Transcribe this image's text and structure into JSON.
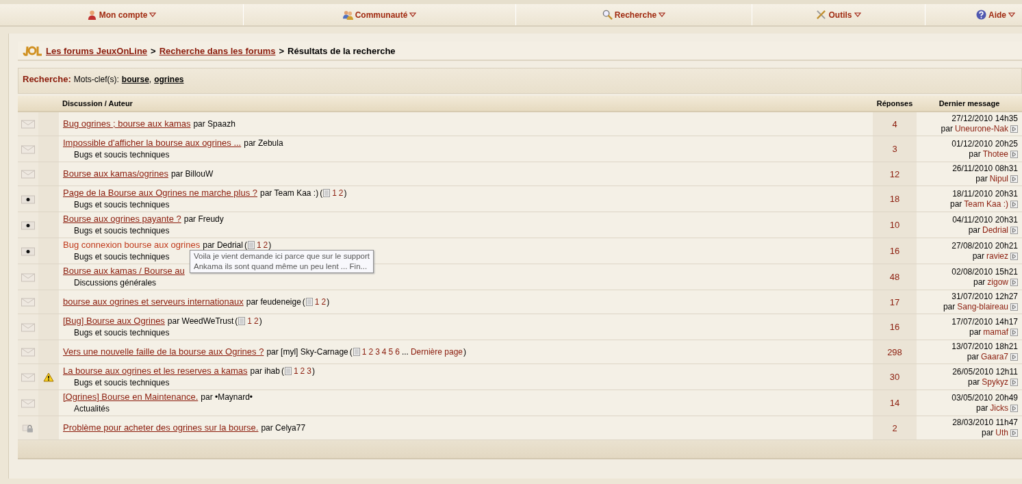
{
  "nav": [
    {
      "label": "Mon compte",
      "kind": "user"
    },
    {
      "label": "Communauté",
      "kind": "people"
    },
    {
      "label": "Recherche",
      "kind": "search"
    },
    {
      "label": "Outils",
      "kind": "tools"
    },
    {
      "label": "Aide",
      "kind": "help"
    }
  ],
  "breadcrumb": [
    {
      "label": "Les forums JeuxOnLine",
      "link": true
    },
    {
      "label": "Recherche dans les forums",
      "link": true
    },
    {
      "label": "Résultats de la recherche",
      "link": false
    }
  ],
  "separator": ">",
  "search": {
    "label": "Recherche:",
    "text": "Mots-clef(s):",
    "keywords": [
      "bourse",
      "ogrines"
    ],
    "comma": ","
  },
  "table": {
    "columns": [
      "Discussion / Auteur",
      "Réponses",
      "Dernier message"
    ],
    "rows": [
      {
        "kind": "read",
        "warning": false,
        "hovered": false,
        "title": "Bug ogrines ; bourse aux kamas",
        "author": "par Spaazh",
        "replies": "4",
        "date": "27/12/2010 14h35",
        "by": "par",
        "last_by": "Uneurone-Nak"
      },
      {
        "kind": "read",
        "warning": false,
        "hovered": false,
        "title": "Impossible d'afficher la bourse aux ogrines ...",
        "author": "par Zebula",
        "forum": "Bugs et soucis techniques",
        "replies": "3",
        "date": "01/12/2010 20h25",
        "by": "par",
        "last_by": "Thotee"
      },
      {
        "kind": "read",
        "warning": false,
        "hovered": false,
        "title": "Bourse aux kamas/ogrines",
        "author": "par BillouW",
        "replies": "12",
        "date": "26/11/2010 08h31",
        "by": "par",
        "last_by": "Nipul"
      },
      {
        "kind": "hot",
        "warning": false,
        "hovered": false,
        "title": "Page de la Bourse aux Ogrines ne marche plus ?",
        "author": "par Team Kaa :)",
        "pages": {
          "open": "(",
          "links": [
            "1",
            "2"
          ],
          "close": ")"
        },
        "forum": "Bugs et soucis techniques",
        "replies": "18",
        "date": "18/11/2010 20h31",
        "by": "par",
        "last_by": "Team Kaa :)"
      },
      {
        "kind": "hot",
        "warning": false,
        "hovered": false,
        "title": "Bourse aux ogrines payante ?",
        "author": "par Freudy",
        "forum": "Bugs et soucis techniques",
        "replies": "10",
        "date": "04/11/2010 20h31",
        "by": "par",
        "last_by": "Dedrial"
      },
      {
        "kind": "hot",
        "warning": false,
        "hovered": true,
        "title": "Bug connexion bourse aux ogrines",
        "author": "par Dedrial",
        "pages": {
          "open": "(",
          "links": [
            "1",
            "2"
          ],
          "close": ")"
        },
        "forum": "Bugs et soucis techniques",
        "replies": "16",
        "date": "27/08/2010 20h21",
        "by": "par",
        "last_by": "raviez",
        "tooltip": [
          "Voila je vient demande ici parce que sur le support",
          "Ankama ils sont quand même un peu lent ... Fin..."
        ]
      },
      {
        "kind": "read",
        "warning": false,
        "hovered": false,
        "title": "Bourse aux kamas / Bourse au",
        "forum": "Discussions générales",
        "replies": "48",
        "date": "02/08/2010 15h21",
        "by": "par",
        "last_by": "zigow"
      },
      {
        "kind": "read",
        "warning": false,
        "hovered": false,
        "title": "bourse aux ogrines et serveurs internationaux",
        "author": "par feudeneige",
        "pages": {
          "open": "(",
          "links": [
            "1",
            "2"
          ],
          "close": ")"
        },
        "replies": "17",
        "date": "31/07/2010 12h27",
        "by": "par",
        "last_by": "Sang-blaireau"
      },
      {
        "kind": "read",
        "warning": false,
        "hovered": false,
        "title": "[Bug] Bourse aux Ogrines",
        "author": "par WeedWeTrust",
        "pages": {
          "open": "(",
          "links": [
            "1",
            "2"
          ],
          "close": ")"
        },
        "forum": "Bugs et soucis techniques",
        "replies": "16",
        "date": "17/07/2010 14h17",
        "by": "par",
        "last_by": "mamaf"
      },
      {
        "kind": "read",
        "warning": false,
        "hovered": false,
        "title": "Vers une nouvelle faille de la bourse aux Ogrines ?",
        "author": "par [myl] Sky-Carnage",
        "pages": {
          "open": "(",
          "links": [
            "1",
            "2",
            "3",
            "4",
            "5",
            "6"
          ],
          "gap": "...",
          "last_page": "Dernière page",
          "close": ")"
        },
        "replies": "298",
        "date": "13/07/2010 18h21",
        "by": "par",
        "last_by": "Gaara7"
      },
      {
        "kind": "read",
        "warning": true,
        "hovered": false,
        "title": "La bourse aux ogrines et les reserves a kamas",
        "author": "par ihab",
        "pages": {
          "open": "(",
          "links": [
            "1",
            "2",
            "3"
          ],
          "close": ")"
        },
        "forum": "Bugs et soucis techniques",
        "replies": "30",
        "date": "26/05/2010 12h11",
        "by": "par",
        "last_by": "Spykyz"
      },
      {
        "kind": "read",
        "warning": false,
        "hovered": false,
        "title": "[Ogrines] Bourse en Maintenance.",
        "author": "par •Maynard•",
        "forum": "Actualités",
        "replies": "14",
        "date": "03/05/2010 20h49",
        "by": "par",
        "last_by": "Jicks"
      },
      {
        "kind": "locked",
        "warning": false,
        "hovered": false,
        "title": "Problème pour acheter des ogrines sur la bourse.",
        "author": "par Celya77",
        "replies": "2",
        "date": "28/03/2010 11h47",
        "by": "par",
        "last_by": "Uth"
      }
    ]
  }
}
